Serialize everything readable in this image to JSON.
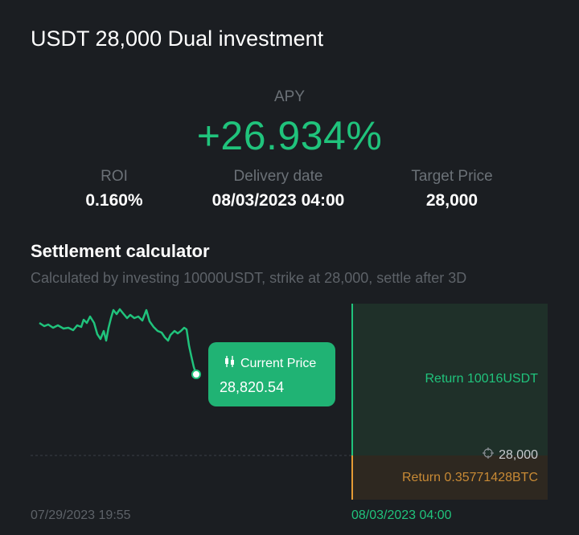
{
  "header": {
    "title": "USDT 28,000 Dual investment"
  },
  "apy": {
    "label": "APY",
    "value": "+26.934%"
  },
  "stats": {
    "roi": {
      "label": "ROI",
      "value": "0.160%"
    },
    "delivery": {
      "label": "Delivery date",
      "value": "08/03/2023 04:00"
    },
    "target": {
      "label": "Target Price",
      "value": "28,000"
    }
  },
  "calculator": {
    "title": "Settlement calculator",
    "subtitle": "Calculated by investing 10000USDT, strike at 28,000, settle after 3D"
  },
  "tooltip": {
    "label": "Current Price",
    "value": "28,820.54",
    "icon": "candlestick-icon"
  },
  "zones": {
    "above": "Return 10016USDT",
    "below": "Return 0.35771428BTC",
    "strike": "28,000",
    "strike_icon": "crosshair-icon"
  },
  "timeline": {
    "start": "07/29/2023 19:55",
    "end": "08/03/2023 04:00"
  },
  "colors": {
    "accent_green": "#20c37c",
    "accent_orange": "#c88a35",
    "background": "#1b1e22"
  }
}
